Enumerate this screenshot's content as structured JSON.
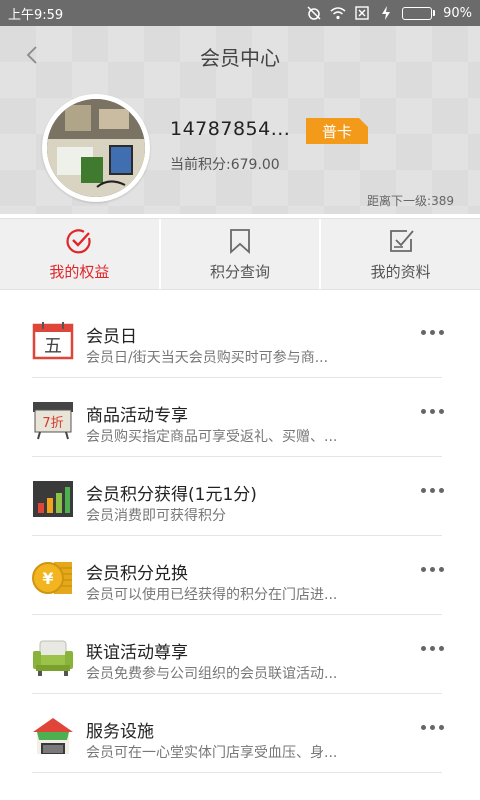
{
  "status_bar": {
    "time": "上午9:59",
    "battery_percent_label": "90%",
    "battery_level": 0.9
  },
  "header": {
    "title": "会员中心",
    "username": "14787854...",
    "badge": "普卡",
    "points_label": "当前积分:679.00",
    "next_level_label": "距离下一级:389"
  },
  "tabs": [
    {
      "label": "我的权益",
      "icon": "checkmark-circle-icon",
      "active": true
    },
    {
      "label": "积分查询",
      "icon": "bookmark-icon",
      "active": false
    },
    {
      "label": "我的资料",
      "icon": "profile-check-icon",
      "active": false
    }
  ],
  "benefits": [
    {
      "title": "会员日",
      "desc": "会员日/街天当天会员购买时可参与商...",
      "icon": "calendar-icon",
      "icon_text": "五"
    },
    {
      "title": "商品活动专享",
      "desc": "会员购买指定商品可享受返礼、买赠、...",
      "icon": "discount-sign-icon",
      "icon_text": "7折"
    },
    {
      "title": "会员积分获得(1元1分)",
      "desc": "会员消费即可获得积分",
      "icon": "bar-chart-icon"
    },
    {
      "title": "会员积分兑换",
      "desc": "会员可以使用已经获得的积分在门店进...",
      "icon": "coin-icon",
      "icon_text": "¥"
    },
    {
      "title": "联谊活动尊享",
      "desc": "会员免费参与公司组织的会员联谊活动...",
      "icon": "sofa-icon"
    },
    {
      "title": "服务设施",
      "desc": "会员可在一心堂实体门店享受血压、身...",
      "icon": "store-icon"
    }
  ],
  "colors": {
    "accent": "#e0262a",
    "badge": "#f39a1b"
  }
}
